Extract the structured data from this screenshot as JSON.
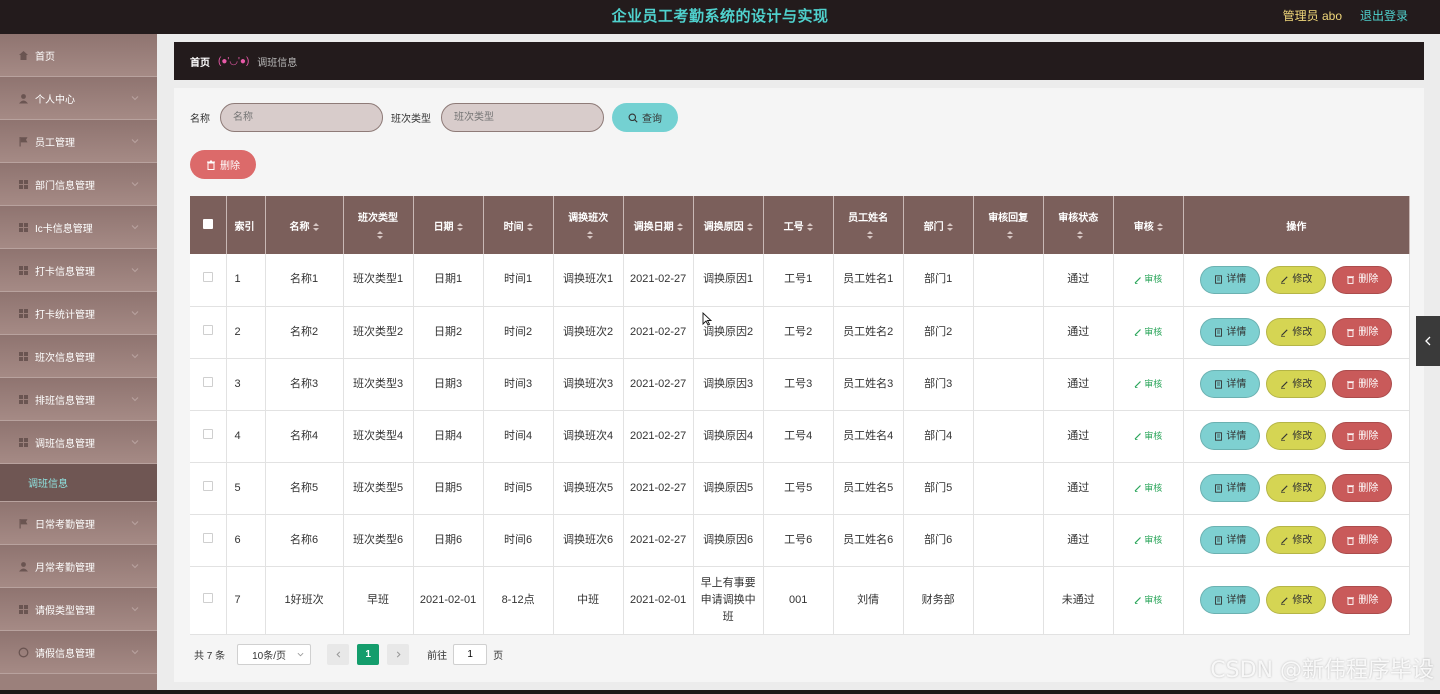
{
  "header": {
    "title": "企业员工考勤系统的设计与实现",
    "admin_label": "管理员 abo",
    "logout_label": "退出登录"
  },
  "sidebar": {
    "items": [
      {
        "label": "首页",
        "icon": "home-icon"
      },
      {
        "label": "个人中心",
        "icon": "user-icon"
      },
      {
        "label": "员工管理",
        "icon": "flag-icon"
      },
      {
        "label": "部门信息管理",
        "icon": "grid-icon"
      },
      {
        "label": "Ic卡信息管理",
        "icon": "grid-icon"
      },
      {
        "label": "打卡信息管理",
        "icon": "grid-icon"
      },
      {
        "label": "打卡统计管理",
        "icon": "grid-icon"
      },
      {
        "label": "班次信息管理",
        "icon": "grid-icon"
      },
      {
        "label": "排班信息管理",
        "icon": "grid-icon"
      },
      {
        "label": "调班信息管理",
        "icon": "grid-icon"
      },
      {
        "label": "日常考勤管理",
        "icon": "flag-icon"
      },
      {
        "label": "月常考勤管理",
        "icon": "user-icon"
      },
      {
        "label": "请假类型管理",
        "icon": "grid-icon"
      },
      {
        "label": "请假信息管理",
        "icon": "circle-icon"
      }
    ],
    "sub_item": "调班信息"
  },
  "breadcrumb": {
    "home": "首页",
    "face": "(●'◡'●)",
    "current": "调班信息"
  },
  "search": {
    "name_label": "名称",
    "name_placeholder": "名称",
    "type_label": "班次类型",
    "type_placeholder": "班次类型",
    "query_label": "查询"
  },
  "batch_delete_label": "删除",
  "table": {
    "columns": [
      "索引",
      "名称",
      "班次类型",
      "日期",
      "时间",
      "调换班次",
      "调换日期",
      "调换原因",
      "工号",
      "员工姓名",
      "部门",
      "审核回复",
      "审核状态",
      "审核",
      "操作"
    ],
    "rows": [
      {
        "index": "1",
        "name": "名称1",
        "shift_type": "班次类型1",
        "date": "日期1",
        "time": "时间1",
        "swap_shift": "调换班次1",
        "swap_date": "2021-02-27",
        "reason": "调换原因1",
        "emp_no": "工号1",
        "emp_name": "员工姓名1",
        "dept": "部门1",
        "reply": "",
        "status": "通过"
      },
      {
        "index": "2",
        "name": "名称2",
        "shift_type": "班次类型2",
        "date": "日期2",
        "time": "时间2",
        "swap_shift": "调换班次2",
        "swap_date": "2021-02-27",
        "reason": "调换原因2",
        "emp_no": "工号2",
        "emp_name": "员工姓名2",
        "dept": "部门2",
        "reply": "",
        "status": "通过"
      },
      {
        "index": "3",
        "name": "名称3",
        "shift_type": "班次类型3",
        "date": "日期3",
        "time": "时间3",
        "swap_shift": "调换班次3",
        "swap_date": "2021-02-27",
        "reason": "调换原因3",
        "emp_no": "工号3",
        "emp_name": "员工姓名3",
        "dept": "部门3",
        "reply": "",
        "status": "通过"
      },
      {
        "index": "4",
        "name": "名称4",
        "shift_type": "班次类型4",
        "date": "日期4",
        "time": "时间4",
        "swap_shift": "调换班次4",
        "swap_date": "2021-02-27",
        "reason": "调换原因4",
        "emp_no": "工号4",
        "emp_name": "员工姓名4",
        "dept": "部门4",
        "reply": "",
        "status": "通过"
      },
      {
        "index": "5",
        "name": "名称5",
        "shift_type": "班次类型5",
        "date": "日期5",
        "time": "时间5",
        "swap_shift": "调换班次5",
        "swap_date": "2021-02-27",
        "reason": "调换原因5",
        "emp_no": "工号5",
        "emp_name": "员工姓名5",
        "dept": "部门5",
        "reply": "",
        "status": "通过"
      },
      {
        "index": "6",
        "name": "名称6",
        "shift_type": "班次类型6",
        "date": "日期6",
        "time": "时间6",
        "swap_shift": "调换班次6",
        "swap_date": "2021-02-27",
        "reason": "调换原因6",
        "emp_no": "工号6",
        "emp_name": "员工姓名6",
        "dept": "部门6",
        "reply": "",
        "status": "通过"
      },
      {
        "index": "7",
        "name": "1好班次",
        "shift_type": "早班",
        "date": "2021-02-01",
        "time": "8-12点",
        "swap_shift": "中班",
        "swap_date": "2021-02-01",
        "reason": "早上有事要申请调换中班",
        "emp_no": "001",
        "emp_name": "刘倩",
        "dept": "财务部",
        "reply": "",
        "status": "未通过"
      }
    ],
    "audit_link": "审核",
    "detail_label": "详情",
    "edit_label": "修改",
    "delete_label": "删除"
  },
  "pagination": {
    "total": "共 7 条",
    "page_size": "10条/页",
    "current_page": "1",
    "goto_label": "前往",
    "goto_value": "1",
    "page_unit": "页"
  },
  "watermark": "CSDN @新伟程序毕设"
}
